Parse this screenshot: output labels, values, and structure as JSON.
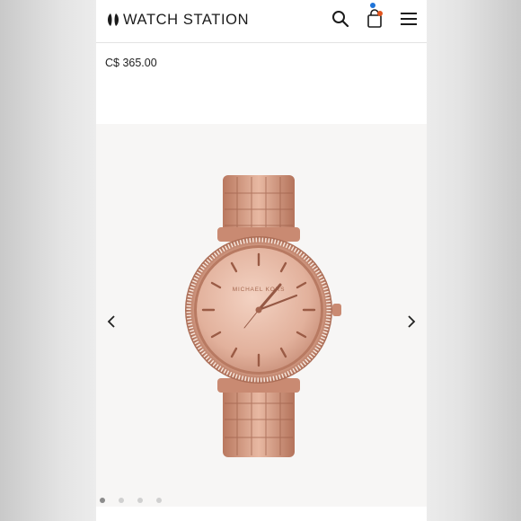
{
  "brand": {
    "name": "WATCH STATION",
    "accent_blue": "#1e74d9",
    "accent_orange": "#e2541e"
  },
  "header": {
    "icons": [
      "logo-mark-icon",
      "search-icon",
      "shopping-bag-icon",
      "hamburger-menu-icon"
    ]
  },
  "product": {
    "price": "C$ 365.00",
    "watch_dial_text": "MICHAEL KORS",
    "color": "#d9a48d"
  },
  "gallery": {
    "prev_icon": "chevron-left-icon",
    "next_icon": "chevron-right-icon",
    "image_count": 4,
    "active_index": 0
  }
}
